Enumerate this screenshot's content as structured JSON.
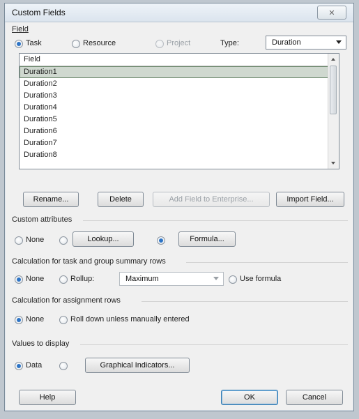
{
  "window": {
    "title": "Custom Fields",
    "close_glyph": "✕"
  },
  "field": {
    "group_label": "Field",
    "options": [
      "Task",
      "Resource",
      "Project"
    ],
    "selected": "Task",
    "type_label": "Type:",
    "type_value": "Duration",
    "list": {
      "header": "Field",
      "rows": [
        "Duration1",
        "Duration2",
        "Duration3",
        "Duration4",
        "Duration5",
        "Duration6",
        "Duration7",
        "Duration8"
      ],
      "selected_row": "Duration1"
    },
    "buttons": {
      "rename": "Rename...",
      "delete": "Delete",
      "add_enterprise": "Add Field to Enterprise...",
      "import": "Import Field..."
    }
  },
  "custom_attributes": {
    "label": "Custom attributes",
    "none": "None",
    "lookup": "Lookup...",
    "formula": "Formula..."
  },
  "calc_summary": {
    "label": "Calculation for task and group summary rows",
    "none": "None",
    "rollup": "Rollup:",
    "rollup_value": "Maximum",
    "use_formula": "Use formula"
  },
  "calc_assignment": {
    "label": "Calculation for assignment rows",
    "none": "None",
    "roll_down": "Roll down unless manually entered"
  },
  "values_display": {
    "label": "Values to display",
    "data": "Data",
    "graphical": "Graphical Indicators..."
  },
  "footer": {
    "help": "Help",
    "ok": "OK",
    "cancel": "Cancel"
  },
  "colors": {
    "accent": "#2d74c6",
    "dialog_bg": "#f0f0f0",
    "selected_row": "#cfd8cf"
  },
  "icons": {
    "close": "close-icon",
    "dropdown": "chevron-down-icon"
  }
}
